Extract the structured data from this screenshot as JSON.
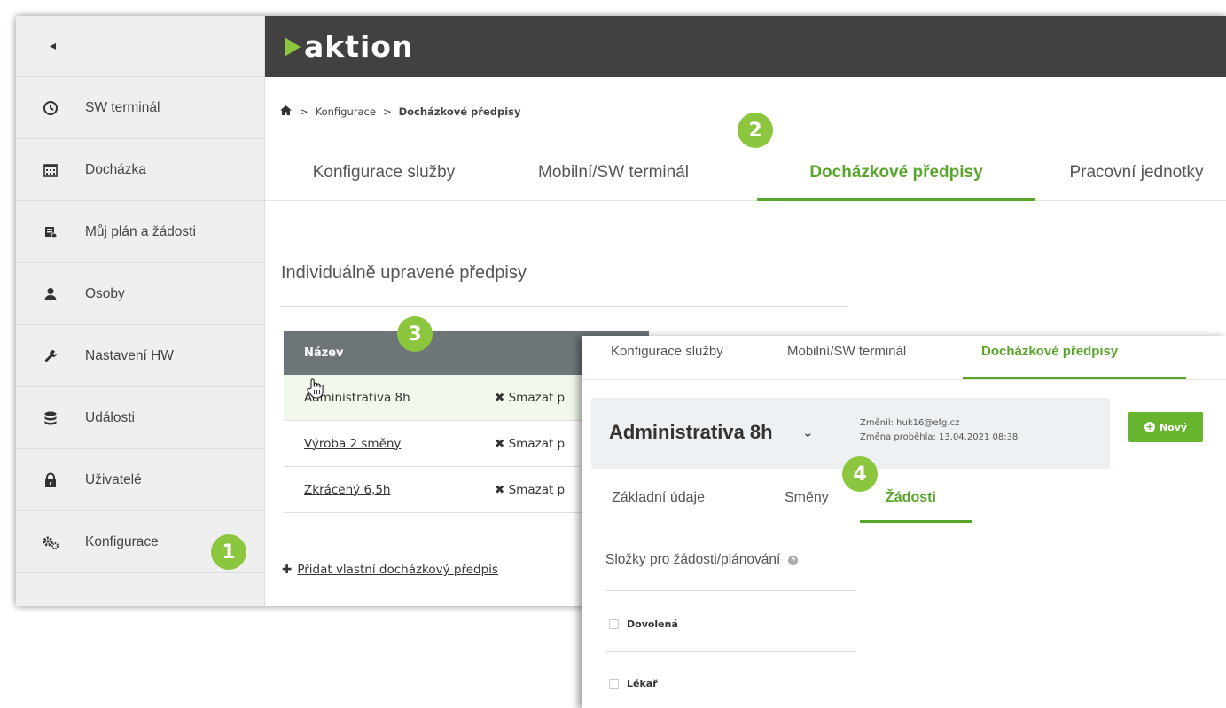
{
  "sidebar": {
    "collapse_glyph": "◂",
    "items": [
      {
        "label": "SW terminál",
        "icon": "clock-icon"
      },
      {
        "label": "Docházka",
        "icon": "calendar-icon"
      },
      {
        "label": "Můj plán a žádosti",
        "icon": "plan-icon"
      },
      {
        "label": "Osoby",
        "icon": "person-icon"
      },
      {
        "label": "Nastavení HW",
        "icon": "wrench-icon"
      },
      {
        "label": "Události",
        "icon": "database-icon"
      },
      {
        "label": "Uživatelé",
        "icon": "lock-icon"
      },
      {
        "label": "Konfigurace",
        "icon": "gears-icon"
      }
    ]
  },
  "header": {
    "logo_text": "aktion",
    "bg_color": "#414141",
    "accent": "#8cc63f"
  },
  "breadcrumb": {
    "sep": ">",
    "level1": "Konfigurace",
    "current": "Docházkové předpisy"
  },
  "tabs": [
    {
      "label": "Konfigurace služby"
    },
    {
      "label": "Mobilní/SW terminál"
    },
    {
      "label": "Docházkové předpisy",
      "active": true
    },
    {
      "label": "Pracovní jednotky"
    }
  ],
  "section": {
    "title": "Individuálně upravené předpisy",
    "table_header": "Název",
    "rows": [
      {
        "name": "Administrativa 8h",
        "delete": "Smazat p"
      },
      {
        "name": "Výroba 2 směny",
        "delete": "Smazat p"
      },
      {
        "name": "Zkrácený 6,5h",
        "delete": "Smazat p"
      }
    ],
    "add_link": "Přidat vlastní docházkový předpis"
  },
  "badges": [
    "1",
    "2",
    "3",
    "4"
  ],
  "detail": {
    "tabs": [
      {
        "label": "Konfigurace služby"
      },
      {
        "label": "Mobilní/SW terminál"
      },
      {
        "label": "Docházkové předpisy",
        "active": true
      }
    ],
    "title": "Administrativa 8h",
    "chevron": "⌄",
    "changed_by": "Změnil: huk16@efg.cz",
    "changed_at": "Změna proběhla: 13.04.2021 08:38",
    "new_button": "Nový",
    "subtabs": [
      {
        "label": "Základní údaje"
      },
      {
        "label": "Směny"
      },
      {
        "label": "Žádosti",
        "active": true
      }
    ],
    "section_title": "Složky pro žádosti/plánování",
    "checkboxes": [
      {
        "label": "Dovolená",
        "checked": false
      },
      {
        "label": "Lékař",
        "checked": false
      }
    ]
  }
}
